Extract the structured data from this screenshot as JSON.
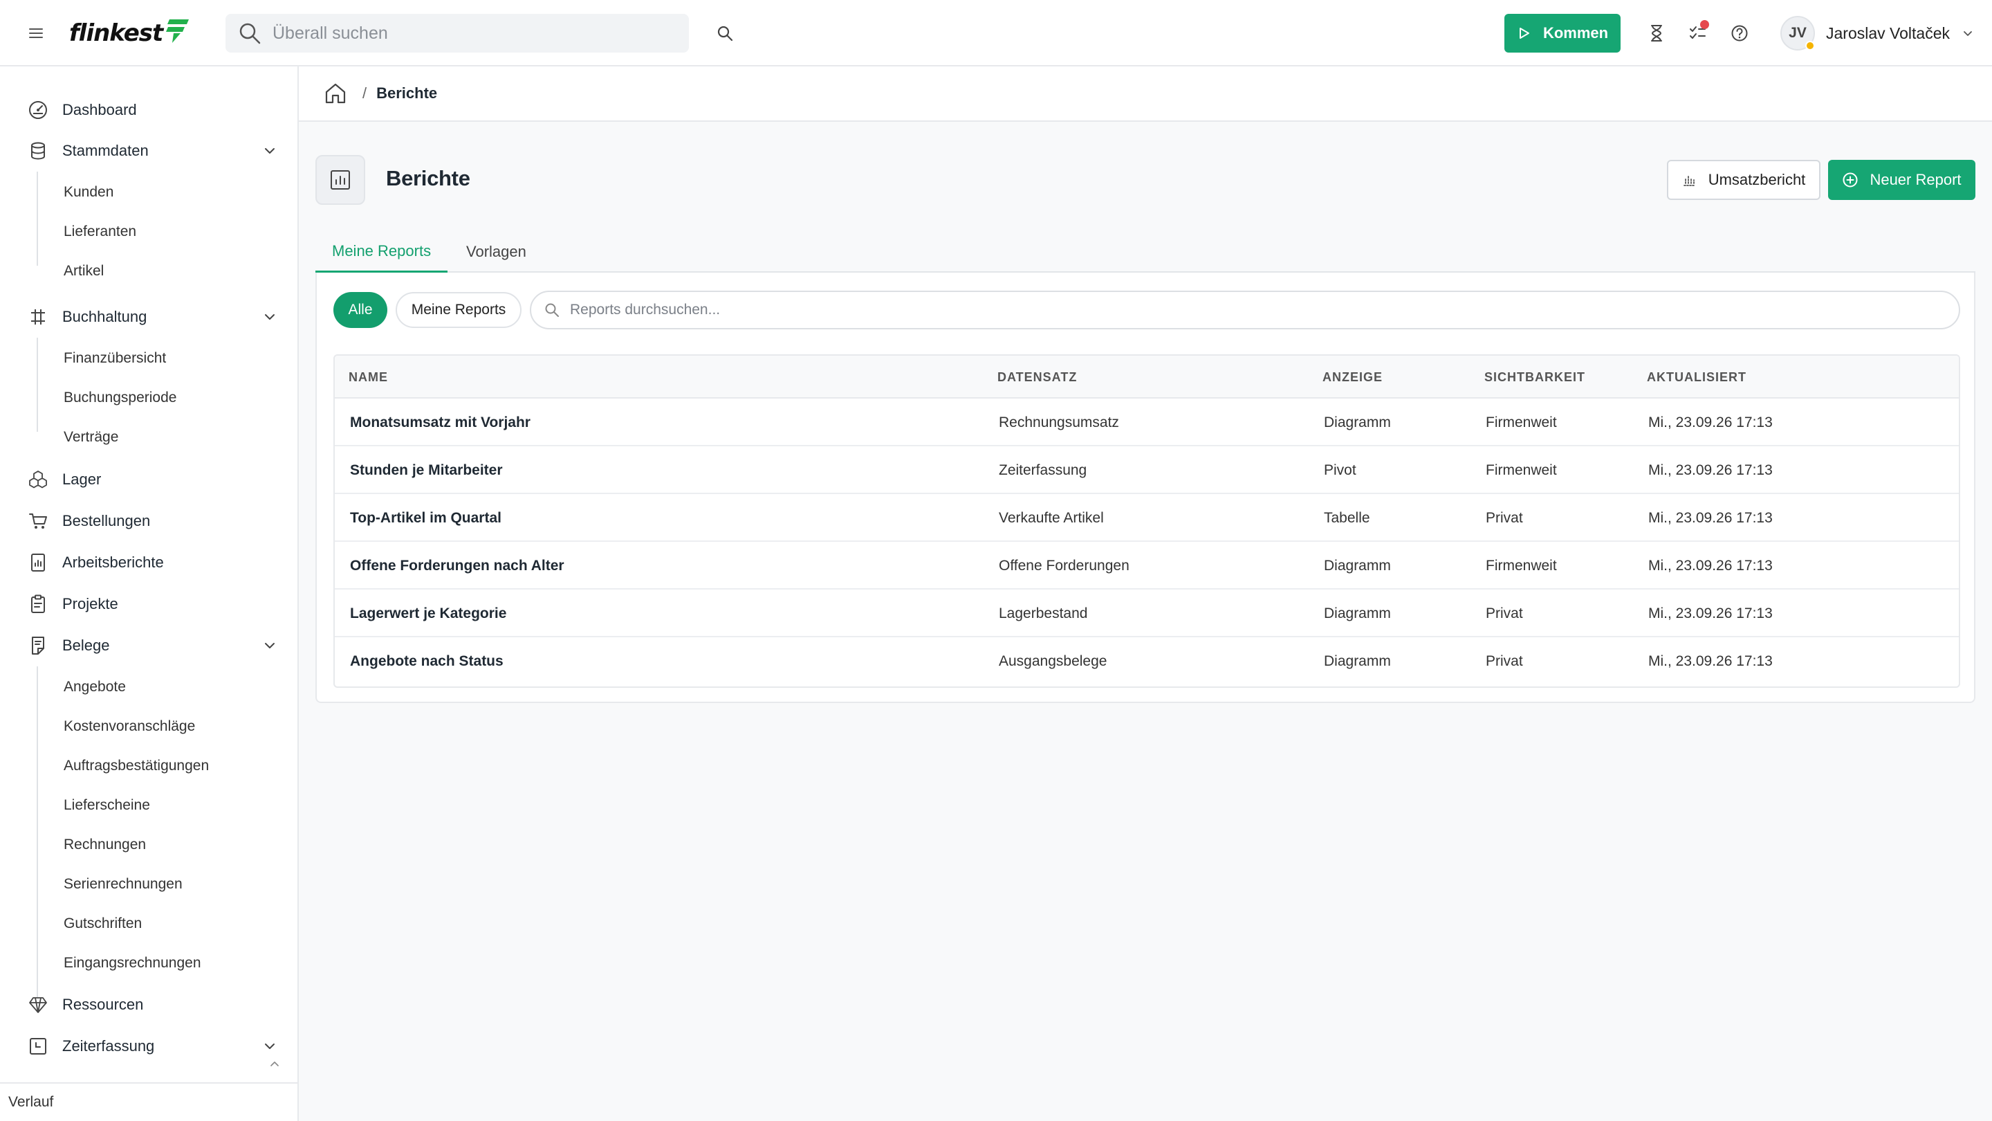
{
  "topbar": {
    "logo_text": "flinkest",
    "search_placeholder": "Überall suchen",
    "kommen_label": "Kommen",
    "user_initials": "JV",
    "user_name": "Jaroslav Voltaček",
    "icons": [
      "menu-icon",
      "search-icon",
      "play-icon",
      "hourglass-icon",
      "tasks-icon",
      "help-icon",
      "chevron-down-icon"
    ],
    "accent_color": "#16a673",
    "notification_color": "#e5484d"
  },
  "sidebar": {
    "items": [
      {
        "label": "Dashboard",
        "icon": "dashboard-icon"
      },
      {
        "label": "Stammdaten",
        "icon": "database-icon",
        "expanded": true,
        "children": [
          "Kunden",
          "Lieferanten",
          "Artikel"
        ]
      },
      {
        "label": "Buchhaltung",
        "icon": "accounting-icon",
        "expanded": true,
        "children": [
          "Finanzübersicht",
          "Buchungsperiode",
          "Verträge"
        ]
      },
      {
        "label": "Lager",
        "icon": "boxes-icon"
      },
      {
        "label": "Bestellungen",
        "icon": "cart-icon"
      },
      {
        "label": "Arbeitsberichte",
        "icon": "report-doc-icon"
      },
      {
        "label": "Projekte",
        "icon": "clipboard-icon"
      },
      {
        "label": "Belege",
        "icon": "document-icon",
        "expanded": true,
        "children": [
          "Angebote",
          "Kostenvoranschläge",
          "Auftragsbestätigungen",
          "Lieferscheine",
          "Rechnungen",
          "Serienrechnungen",
          "Gutschriften",
          "Eingangsrechnungen"
        ]
      },
      {
        "label": "Ressourcen",
        "icon": "diamond-icon"
      },
      {
        "label": "Zeiterfassung",
        "icon": "time-tracking-icon",
        "expanded": true
      }
    ],
    "bottom_label": "Verlauf"
  },
  "breadcrumb": {
    "home_icon": "home-icon",
    "separator": "/",
    "current": "Berichte"
  },
  "page": {
    "title": "Berichte",
    "umsatz_button": "Umsatzbericht",
    "neuer_button": "Neuer Report"
  },
  "tabs": [
    {
      "label": "Meine Reports",
      "active": true
    },
    {
      "label": "Vorlagen",
      "active": false
    }
  ],
  "filters": {
    "chips": [
      {
        "label": "Alle",
        "active": true
      },
      {
        "label": "Meine Reports",
        "active": false
      }
    ],
    "search_placeholder": "Reports durchsuchen..."
  },
  "table": {
    "columns": [
      "NAME",
      "DATENSATZ",
      "ANZEIGE",
      "SICHTBARKEIT",
      "AKTUALISIERT"
    ],
    "rows": [
      {
        "name": "Monatsumsatz mit Vorjahr",
        "datensatz": "Rechnungsumsatz",
        "anzeige": "Diagramm",
        "sichtbarkeit": "Firmenweit",
        "aktualisiert": "Mi., 23.09.26 17:13"
      },
      {
        "name": "Stunden je Mitarbeiter",
        "datensatz": "Zeiterfassung",
        "anzeige": "Pivot",
        "sichtbarkeit": "Firmenweit",
        "aktualisiert": "Mi., 23.09.26 17:13"
      },
      {
        "name": "Top-Artikel im Quartal",
        "datensatz": "Verkaufte Artikel",
        "anzeige": "Tabelle",
        "sichtbarkeit": "Privat",
        "aktualisiert": "Mi., 23.09.26 17:13"
      },
      {
        "name": "Offene Forderungen nach Alter",
        "datensatz": "Offene Forderungen",
        "anzeige": "Diagramm",
        "sichtbarkeit": "Firmenweit",
        "aktualisiert": "Mi., 23.09.26 17:13"
      },
      {
        "name": "Lagerwert je Kategorie",
        "datensatz": "Lagerbestand",
        "anzeige": "Diagramm",
        "sichtbarkeit": "Privat",
        "aktualisiert": "Mi., 23.09.26 17:13"
      },
      {
        "name": "Angebote nach Status",
        "datensatz": "Ausgangsbelege",
        "anzeige": "Diagramm",
        "sichtbarkeit": "Privat",
        "aktualisiert": "Mi., 23.09.26 17:13"
      }
    ]
  }
}
